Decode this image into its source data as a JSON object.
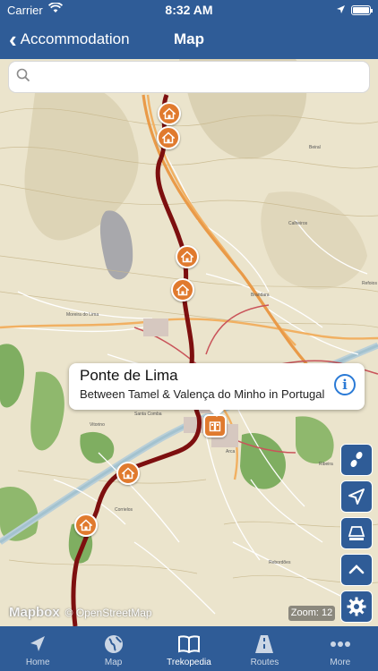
{
  "status_bar": {
    "carrier": "Carrier",
    "time": "8:32 AM"
  },
  "nav": {
    "back_label": "Accommodation",
    "title": "Map"
  },
  "search": {
    "placeholder": "",
    "value": ""
  },
  "callout": {
    "name": "Ponte de Lima",
    "description": "Between Tamel & Valença do Minho in Portugal",
    "info_glyph": "i"
  },
  "map": {
    "attribution_logo": "Mapbox",
    "attribution_text": "© OpenStreetMap",
    "zoom_text": "Zoom: 12",
    "place_labels": [
      "Moreira do Lima",
      "Ponte de Lima",
      "Arca",
      "Corrielos",
      "Calheiros",
      "Brandara",
      "Beiral",
      "Santa Comba",
      "Vitorino",
      "Ribeira",
      "Refoios",
      "Rebordões"
    ],
    "route_color": "#8b1111",
    "pin_color": "#e07a2e"
  },
  "map_controls": [
    "walking-feet-icon",
    "navigation-arrow-icon",
    "layers-icon",
    "chevron-up-icon",
    "settings-gear-icon"
  ],
  "tabs": [
    {
      "label": "Home",
      "icon": "navigation-arrow-icon",
      "active": false
    },
    {
      "label": "Map",
      "icon": "globe-icon",
      "active": false
    },
    {
      "label": "Trekopedia",
      "icon": "book-icon",
      "active": true
    },
    {
      "label": "Routes",
      "icon": "road-icon",
      "active": false
    },
    {
      "label": "More",
      "icon": "ellipsis-icon",
      "active": false
    }
  ]
}
